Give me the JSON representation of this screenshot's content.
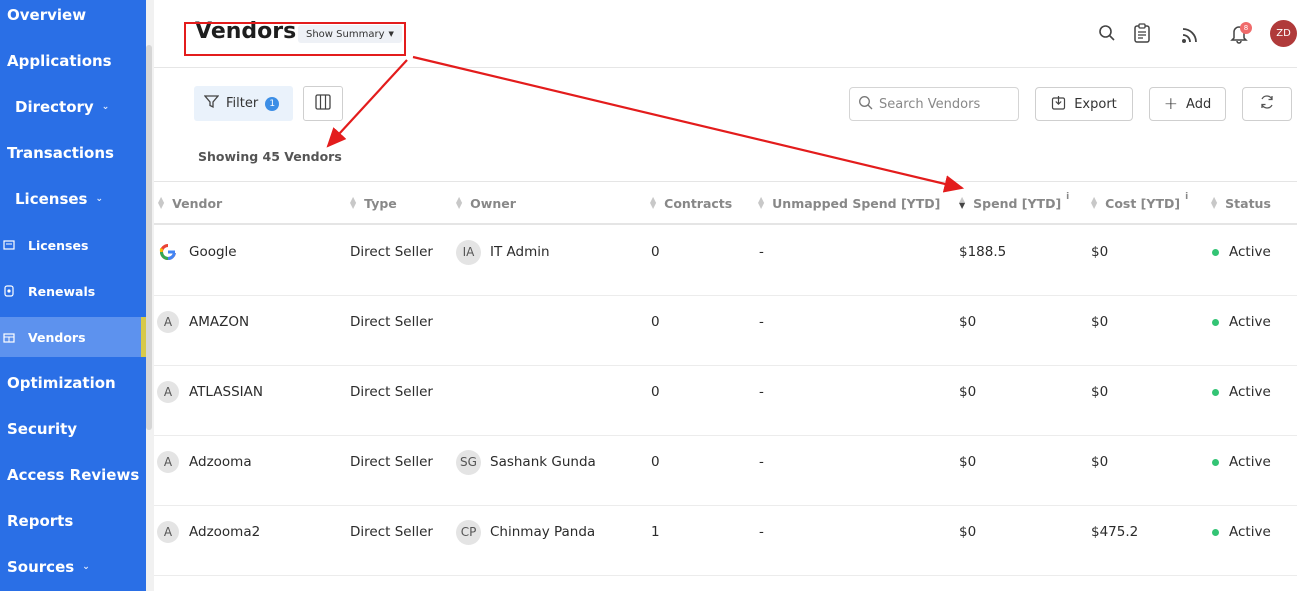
{
  "sidebar": {
    "items": [
      {
        "label": "Overview",
        "chevron": false
      },
      {
        "label": "Applications",
        "chevron": false
      },
      {
        "label": "Directory",
        "chevron": true
      },
      {
        "label": "Transactions",
        "chevron": false
      },
      {
        "label": "Licenses",
        "chevron": true
      },
      {
        "label": "Licenses",
        "icon": "license-icon"
      },
      {
        "label": "Renewals",
        "icon": "renewal-icon"
      },
      {
        "label": "Vendors",
        "icon": "vendor-icon",
        "active": true
      },
      {
        "label": "Optimization",
        "chevron": false
      },
      {
        "label": "Security",
        "chevron": false
      },
      {
        "label": "Access Reviews",
        "chevron": false
      },
      {
        "label": "Reports",
        "chevron": false
      },
      {
        "label": "Sources",
        "chevron": true
      }
    ],
    "color": "#2a6fe6"
  },
  "header": {
    "title": "Vendors",
    "summary_label": "Show Summary",
    "avatar_initials": "ZD",
    "notification_count": "8",
    "icons": [
      "search-icon",
      "clipboard-icon",
      "rss-icon",
      "bell-icon"
    ]
  },
  "toolbar": {
    "filter_label": "Filter",
    "filter_count": "1",
    "search_placeholder": "Search Vendors",
    "export_label": "Export",
    "add_label": "Add"
  },
  "summary_text": "Showing 45 Vendors",
  "table": {
    "columns": [
      "Vendor",
      "Type",
      "Owner",
      "Contracts",
      "Unmapped Spend [YTD]",
      "Spend [YTD]",
      "Cost [YTD]",
      "Status"
    ],
    "rows": [
      {
        "vendor": "Google",
        "logo": "google",
        "type": "Direct Seller",
        "owner_initials": "IA",
        "owner": "IT Admin",
        "contracts": "0",
        "unmapped": "-",
        "spend": "$188.5",
        "cost": "$0",
        "status": "Active"
      },
      {
        "vendor": "AMAZON",
        "initial": "A",
        "type": "Direct Seller",
        "owner_initials": "",
        "owner": "",
        "contracts": "0",
        "unmapped": "-",
        "spend": "$0",
        "cost": "$0",
        "status": "Active"
      },
      {
        "vendor": "ATLASSIAN",
        "initial": "A",
        "type": "Direct Seller",
        "owner_initials": "",
        "owner": "",
        "contracts": "0",
        "unmapped": "-",
        "spend": "$0",
        "cost": "$0",
        "status": "Active"
      },
      {
        "vendor": "Adzooma",
        "initial": "A",
        "type": "Direct Seller",
        "owner_initials": "SG",
        "owner": "Sashank Gunda",
        "contracts": "0",
        "unmapped": "-",
        "spend": "$0",
        "cost": "$0",
        "status": "Active"
      },
      {
        "vendor": "Adzooma2",
        "initial": "A",
        "type": "Direct Seller",
        "owner_initials": "CP",
        "owner": "Chinmay Panda",
        "contracts": "1",
        "unmapped": "-",
        "spend": "$0",
        "cost": "$475.2",
        "status": "Active"
      }
    ]
  },
  "colors": {
    "accent": "#2a6fe6",
    "annotation": "#e31c1c",
    "active_status": "#33c474"
  }
}
